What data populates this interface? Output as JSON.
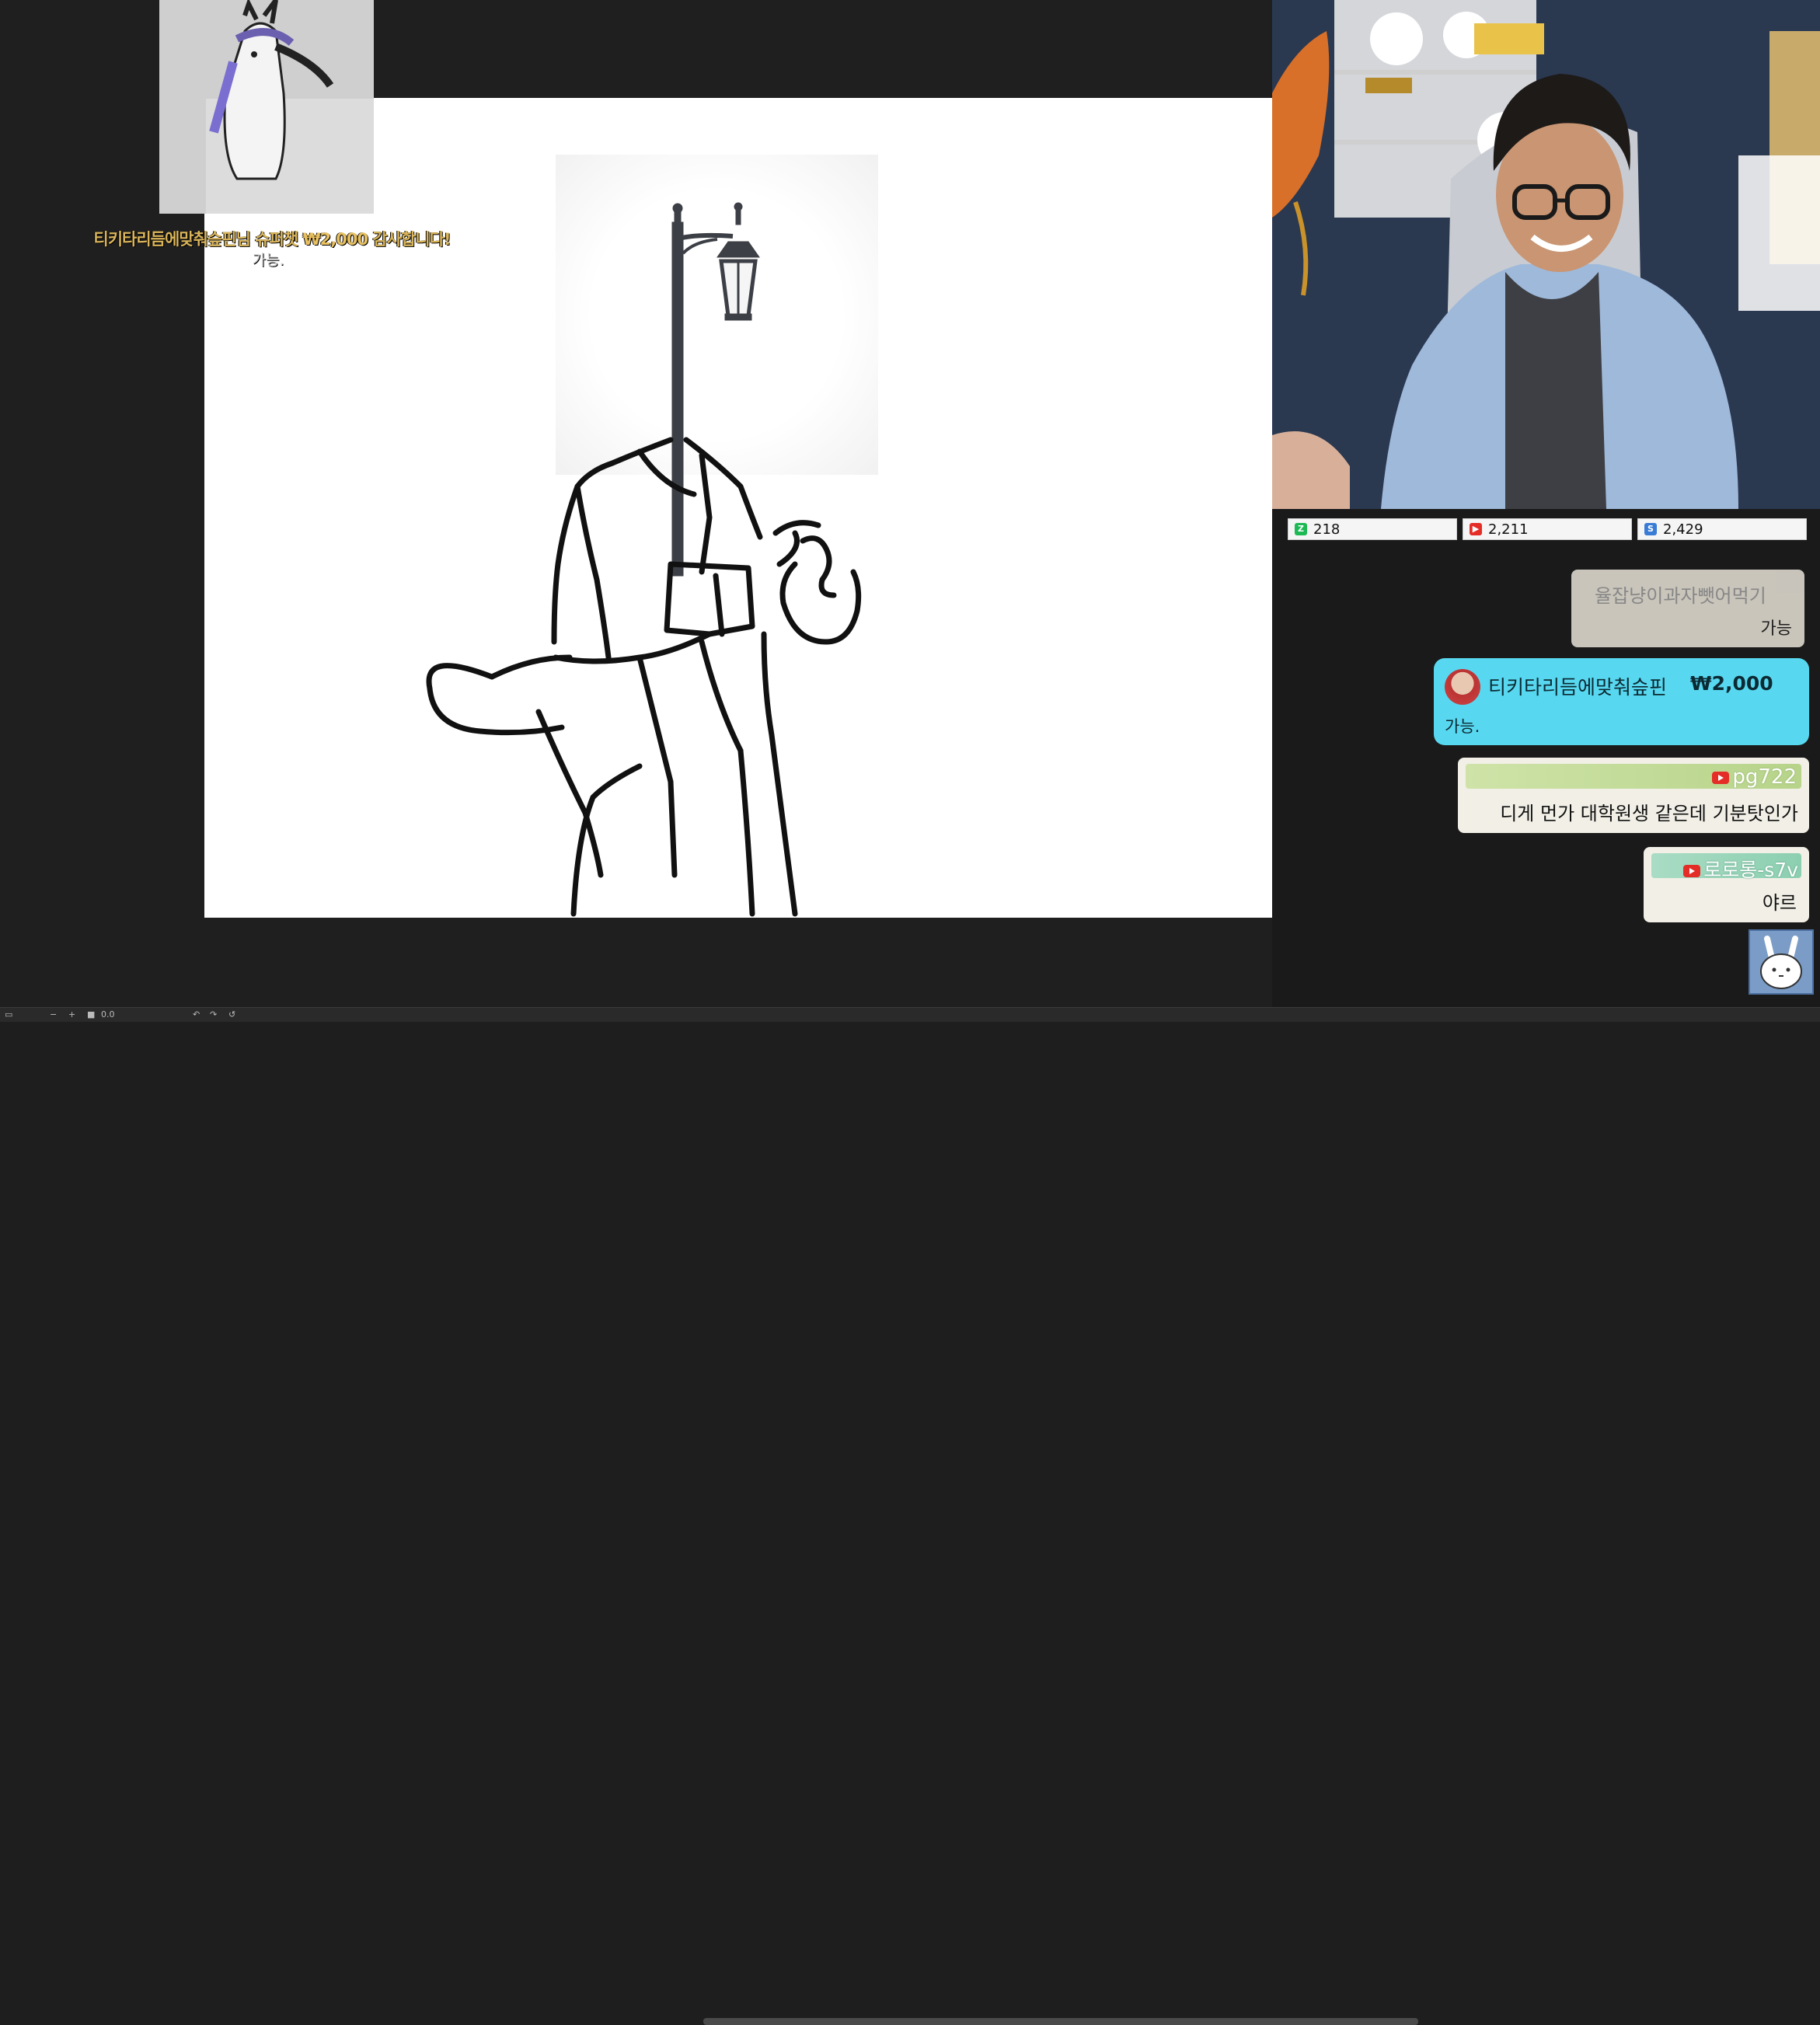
{
  "alert": {
    "donor": "티키타리듬에맞춰슾핀님",
    "middle": " 슈퍼챗 ",
    "amount": "₩2,000",
    "suffix": " 감사합니다!",
    "message": "가능."
  },
  "stats": [
    {
      "icon": "chzzk-icon",
      "color": "#1db954",
      "glyph": "Z",
      "value": "218"
    },
    {
      "icon": "youtube-icon",
      "color": "#e52d27",
      "glyph": "▶",
      "value": "2,211"
    },
    {
      "icon": "soop-icon",
      "color": "#3a7bd5",
      "glyph": "S",
      "value": "2,429"
    }
  ],
  "chat": [
    {
      "name": "율잡냥이과자뺏어먹기",
      "message": "가능"
    },
    {
      "name": "티키타리듬에맞춰슾핀",
      "amount": "₩2,000",
      "message": "가능."
    },
    {
      "name": "pg722",
      "message": "디게 먼가 대학원생 같은데 기분탓인가"
    },
    {
      "name": "로로롱-s7v",
      "message": "야르"
    }
  ],
  "toolbar": {
    "zoom_value": "0.0"
  },
  "colors": {
    "donation_bubble": "#58d8f0",
    "alert_text": "#d9b45a",
    "background": "#1e1e1e"
  }
}
